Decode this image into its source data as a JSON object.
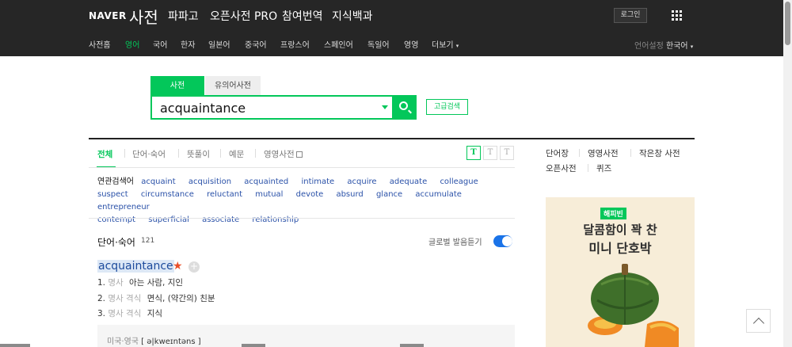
{
  "header": {
    "logo": "NAVER",
    "service": "사전",
    "top_links": [
      "파파고",
      "오픈사전 PRO",
      "참여번역",
      "지식백과"
    ],
    "login": "로그인",
    "nav": [
      "사전홈",
      "영어",
      "국어",
      "한자",
      "일본어",
      "중국어",
      "프랑스어",
      "스페인어",
      "독일어",
      "영영",
      "더보기"
    ],
    "nav_active": "영어",
    "language_setting_label": "언어설정",
    "language_setting_value": "한국어"
  },
  "search": {
    "tab_dict": "사전",
    "tab_synonym": "유의어사전",
    "query": "acquaintance",
    "advanced": "고급검색"
  },
  "filter_tabs": [
    "전체",
    "단어·숙어",
    "뜻풀이",
    "예문",
    "영영사전"
  ],
  "filter_active": "전체",
  "text_size_buttons": [
    "T",
    "T",
    "T"
  ],
  "related": {
    "label": "연관검색어",
    "terms": [
      "acquaint",
      "acquisition",
      "acquainted",
      "intimate",
      "acquire",
      "adequate",
      "colleague",
      "suspect",
      "circumstance",
      "reluctant",
      "mutual",
      "devote",
      "absurd",
      "glance",
      "accumulate",
      "entrepreneur",
      "contempt",
      "superficial",
      "associate",
      "relationship"
    ]
  },
  "results": {
    "section_title": "단어·숙어",
    "count": "121",
    "global_pron_label": "글로벌 발음듣기",
    "global_pron_on": true,
    "entry": {
      "word": "acquaintance",
      "meanings": [
        {
          "num": "1.",
          "pos": "명사",
          "text": "아는 사람, 지인"
        },
        {
          "num": "2.",
          "pos": "명사 격식",
          "text": "면식, (약간의) 친분"
        },
        {
          "num": "3.",
          "pos": "명사 격식",
          "text": "지식"
        }
      ],
      "pron_label": "미국·영국",
      "pron_text": "[ ə|kweɪntəns ]"
    }
  },
  "sidebar": {
    "links": [
      "단어장",
      "영영사전",
      "작은창 사전",
      "오픈사전",
      "퀴즈"
    ],
    "ad": {
      "brand": "해피빈",
      "line1": "달콤함이 꽉 찬",
      "line2": "미니 단호박"
    }
  },
  "colors": {
    "accent": "#03c75a",
    "topbar": "#262626",
    "link": "#2a51a8"
  }
}
